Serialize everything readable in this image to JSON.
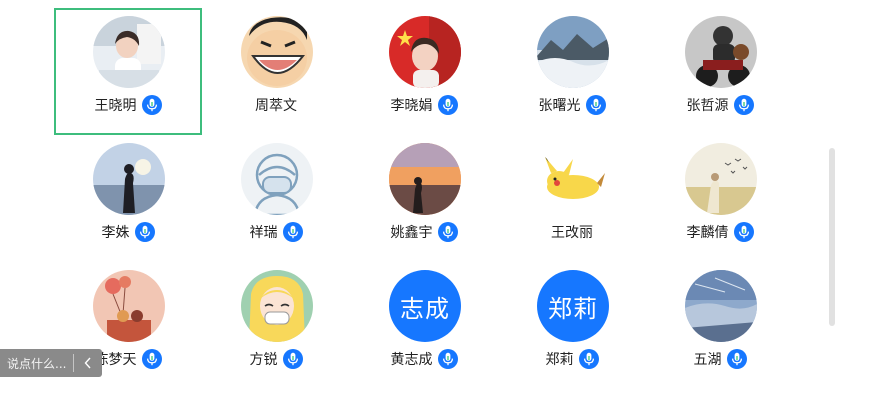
{
  "colors": {
    "selection_border": "#3dbd7d",
    "mic_badge": "#1677ff",
    "text_avatar_bg": "#1677ff",
    "scrollbar": "#e1e1e1",
    "comment_bar_bg": "#8a8a8a"
  },
  "participants": [
    {
      "name": "王晓明",
      "has_mic_icon": true,
      "selected": true,
      "avatar_icon": "child-photo-avatar"
    },
    {
      "name": "周萃文",
      "has_mic_icon": false,
      "selected": false,
      "avatar_icon": "cartoon-laughing-avatar"
    },
    {
      "name": "李晓娟",
      "has_mic_icon": true,
      "selected": false,
      "avatar_icon": "girl-flag-photo-avatar"
    },
    {
      "name": "张曙光",
      "has_mic_icon": true,
      "selected": false,
      "avatar_icon": "mountain-sea-of-clouds-avatar"
    },
    {
      "name": "张哲源",
      "has_mic_icon": true,
      "selected": false,
      "avatar_icon": "motorcycle-bear-avatar"
    },
    {
      "name": "李姝",
      "has_mic_icon": true,
      "selected": false,
      "avatar_icon": "seaside-silhouette-avatar"
    },
    {
      "name": "祥瑞",
      "has_mic_icon": true,
      "selected": false,
      "avatar_icon": "masked-figure-drawing-avatar"
    },
    {
      "name": "姚鑫宇",
      "has_mic_icon": true,
      "selected": false,
      "avatar_icon": "sunset-silhouette-avatar"
    },
    {
      "name": "王改丽",
      "has_mic_icon": false,
      "selected": false,
      "avatar_icon": "pikachu-avatar"
    },
    {
      "name": "李麟倩",
      "has_mic_icon": true,
      "selected": false,
      "avatar_icon": "field-birds-avatar"
    },
    {
      "name": "陈梦天",
      "has_mic_icon": true,
      "selected": false,
      "avatar_icon": "balloon-illustration-avatar"
    },
    {
      "name": "方锐",
      "has_mic_icon": true,
      "selected": false,
      "avatar_icon": "anime-girl-mask-avatar"
    },
    {
      "name": "黄志成",
      "has_mic_icon": true,
      "selected": false,
      "avatar_icon": "text-avatar",
      "avatar_text": "志成"
    },
    {
      "name": "郑莉",
      "has_mic_icon": true,
      "selected": false,
      "avatar_icon": "text-avatar",
      "avatar_text": "郑莉"
    },
    {
      "name": "五湖",
      "has_mic_icon": true,
      "selected": false,
      "avatar_icon": "blue-sky-avatar"
    }
  ],
  "comment_bar": {
    "placeholder": "说点什么...",
    "collapse_icon": "chevron-left-icon"
  }
}
